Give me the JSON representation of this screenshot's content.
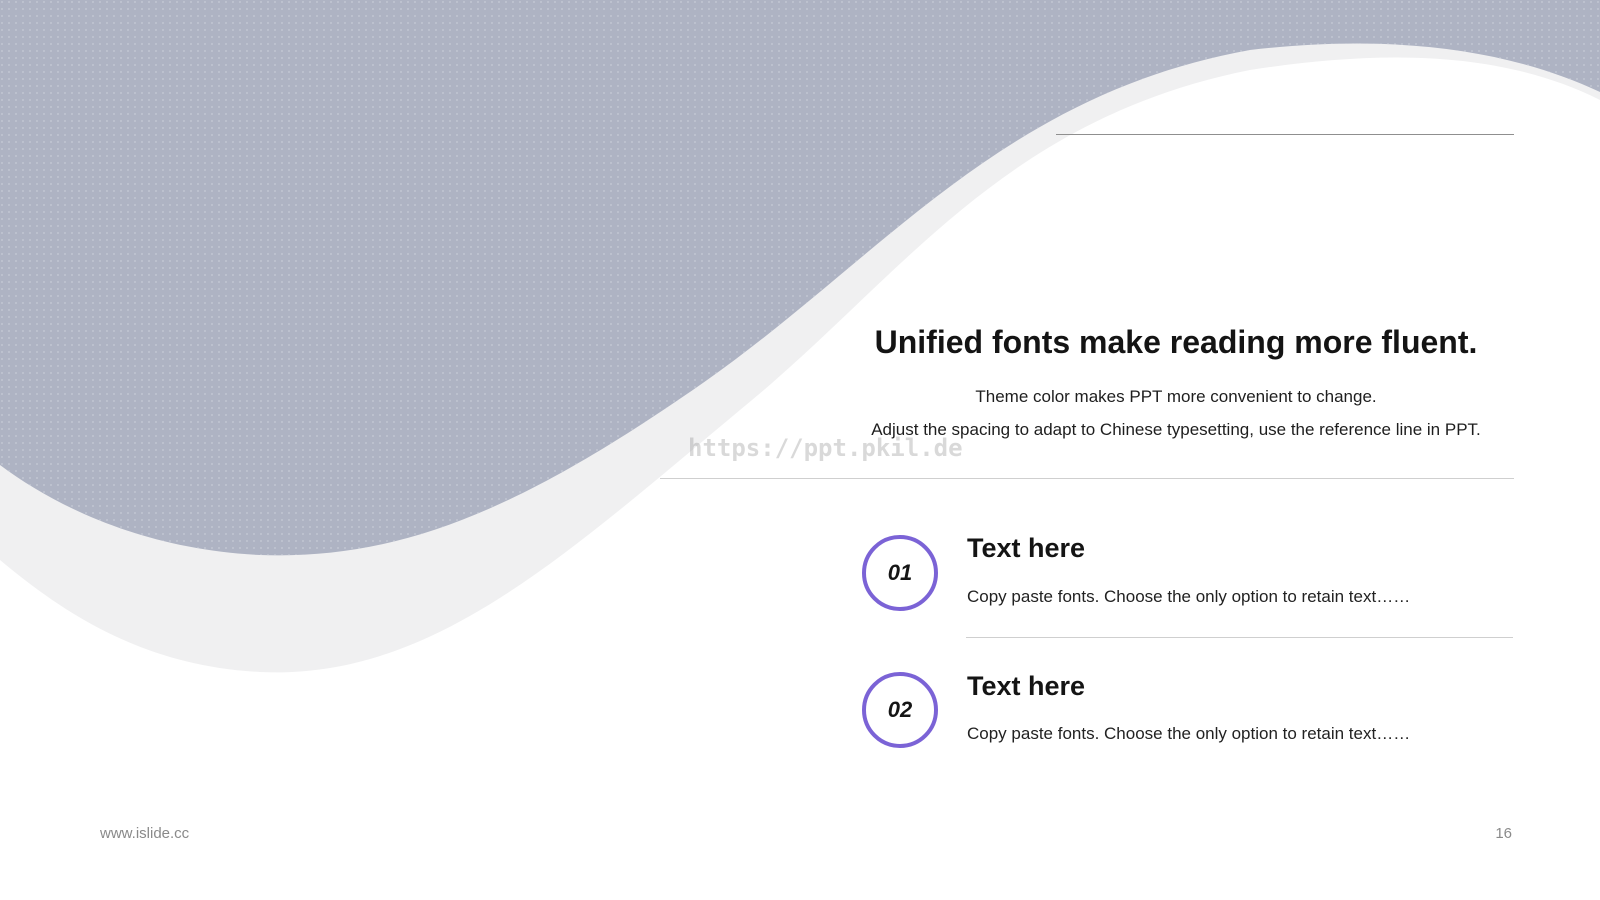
{
  "colors": {
    "wave_fill": "#aeb3c3",
    "wave_shadow": "#f0f0f1",
    "accent": "#7b63d6",
    "text_dark": "#141414",
    "footer_text": "#8a8a8a"
  },
  "slide": {
    "title": "Unified fonts make reading more fluent.",
    "subtitle_lines": [
      "Theme color makes PPT more convenient to change.",
      "Adjust the spacing to adapt to Chinese typesetting, use the reference line in PPT."
    ],
    "watermark": "https://ppt.pkil.de"
  },
  "items": [
    {
      "number": "01",
      "heading": "Text here",
      "body": "Copy paste fonts. Choose the only option to retain text……"
    },
    {
      "number": "02",
      "heading": "Text here",
      "body": "Copy paste fonts. Choose the only option to retain text……"
    }
  ],
  "footer": {
    "website": "www.islide.cc",
    "page_number": "16"
  }
}
